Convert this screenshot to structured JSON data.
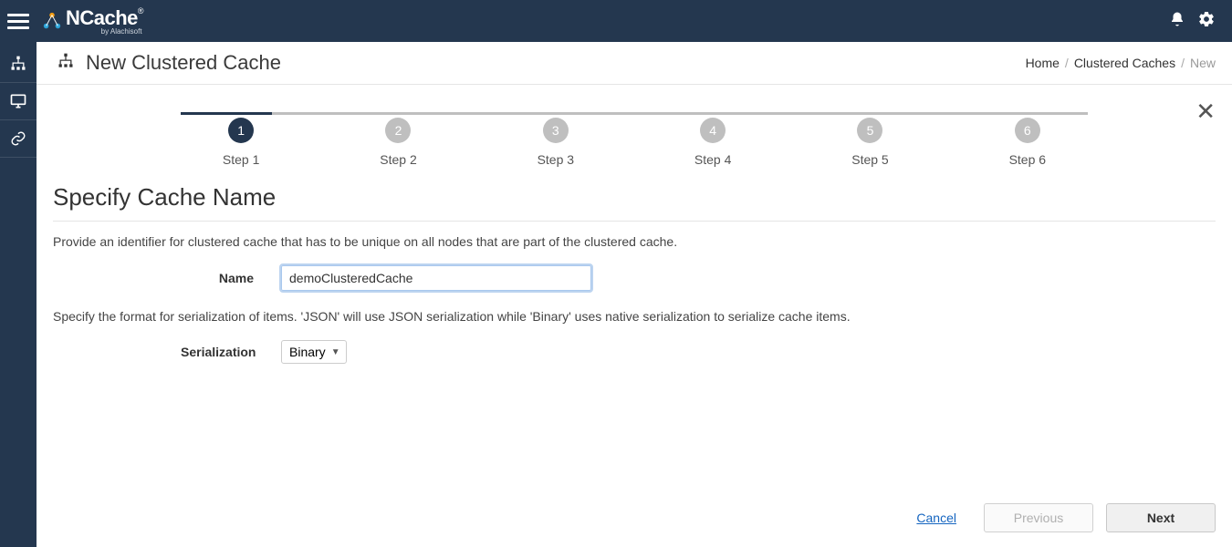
{
  "app": {
    "name": "NCache",
    "vendor": "by Alachisoft"
  },
  "header": {
    "title": "New Clustered Cache",
    "breadcrumb": {
      "home": "Home",
      "parent": "Clustered Caches",
      "current": "New"
    }
  },
  "stepper": {
    "steps": [
      {
        "num": "1",
        "label": "Step 1",
        "active": true
      },
      {
        "num": "2",
        "label": "Step 2",
        "active": false
      },
      {
        "num": "3",
        "label": "Step 3",
        "active": false
      },
      {
        "num": "4",
        "label": "Step 4",
        "active": false
      },
      {
        "num": "5",
        "label": "Step 5",
        "active": false
      },
      {
        "num": "6",
        "label": "Step 6",
        "active": false
      }
    ]
  },
  "section": {
    "title": "Specify Cache Name",
    "desc1": "Provide an identifier for clustered cache that has to be unique on all nodes that are part of the clustered cache.",
    "nameLabel": "Name",
    "nameValue": "demoClusteredCache",
    "desc2": "Specify the format for serialization of items. 'JSON' will use JSON serialization while 'Binary' uses native serialization to serialize cache items.",
    "serLabel": "Serialization",
    "serValue": "Binary"
  },
  "footer": {
    "cancel": "Cancel",
    "previous": "Previous",
    "next": "Next"
  }
}
